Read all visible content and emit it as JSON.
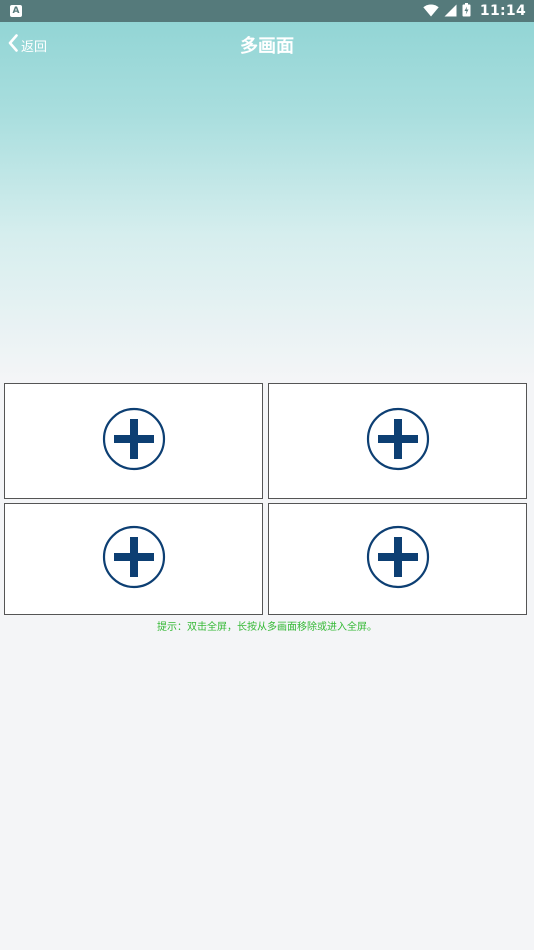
{
  "status_bar": {
    "time": "11:14",
    "notification_icon": "A",
    "icons": [
      "wifi-icon",
      "signal-icon",
      "battery-icon"
    ]
  },
  "header": {
    "back_label": "返回",
    "title": "多画面"
  },
  "grid": {
    "cells": [
      {
        "icon": "add-icon"
      },
      {
        "icon": "add-icon"
      },
      {
        "icon": "add-icon"
      },
      {
        "icon": "add-icon"
      }
    ]
  },
  "hint": "提示：双击全屏，长按从多画面移除或进入全屏。",
  "colors": {
    "status_bar": "#557a7b",
    "gradient_top": "#8dd3d3",
    "background": "#f4f5f7",
    "add_icon": "#0d3f73",
    "hint_text": "#35b935"
  }
}
